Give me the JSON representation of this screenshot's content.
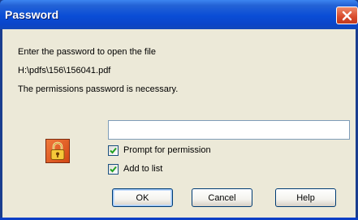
{
  "dialog": {
    "title": "Password",
    "message_line1": "Enter the password to open the file",
    "file_path": "H:\\pdfs\\156\\156041.pdf",
    "message_line3": "The permissions password is necessary."
  },
  "password_field": {
    "value": "",
    "placeholder": ""
  },
  "options": {
    "prompt_for_permission": {
      "label": "Prompt for permission",
      "checked": true
    },
    "add_to_list": {
      "label": "Add to list",
      "checked": true
    }
  },
  "buttons": {
    "ok": "OK",
    "cancel": "Cancel",
    "help": "Help"
  },
  "icons": {
    "dialog_icon": "lock-icon",
    "close": "close-icon"
  },
  "colors": {
    "titlebar_blue": "#0a4dd6",
    "client_bg": "#ece9d8",
    "close_red": "#d8492a",
    "lock_orange": "#e05a20",
    "check_green": "#21a121"
  }
}
